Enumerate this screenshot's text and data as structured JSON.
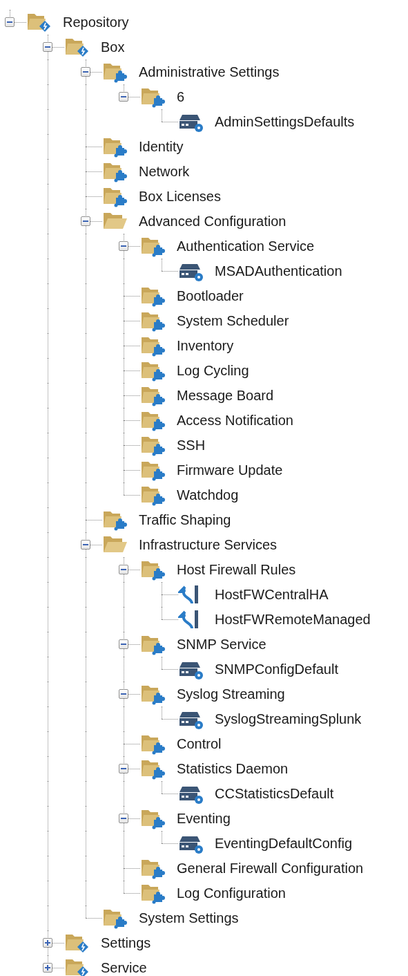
{
  "tree": [
    {
      "label": "Repository",
      "kind": "repo",
      "expanded": true,
      "children": [
        {
          "label": "Box",
          "kind": "repo",
          "expanded": true,
          "children": [
            {
              "label": "Administrative Settings",
              "kind": "config",
              "expanded": true,
              "children": [
                {
                  "label": "6",
                  "kind": "config",
                  "expanded": true,
                  "children": [
                    {
                      "label": "AdminSettingsDefaults",
                      "kind": "object"
                    }
                  ]
                }
              ]
            },
            {
              "label": "Identity",
              "kind": "config"
            },
            {
              "label": "Network",
              "kind": "config"
            },
            {
              "label": "Box Licenses",
              "kind": "config"
            },
            {
              "label": "Advanced Configuration",
              "kind": "open",
              "expanded": true,
              "children": [
                {
                  "label": "Authentication Service",
                  "kind": "config",
                  "expanded": true,
                  "children": [
                    {
                      "label": "MSADAuthentication",
                      "kind": "object"
                    }
                  ]
                },
                {
                  "label": "Bootloader",
                  "kind": "config"
                },
                {
                  "label": "System Scheduler",
                  "kind": "config"
                },
                {
                  "label": "Inventory",
                  "kind": "config"
                },
                {
                  "label": "Log Cycling",
                  "kind": "config"
                },
                {
                  "label": "Message Board",
                  "kind": "config"
                },
                {
                  "label": "Access Notification",
                  "kind": "config"
                },
                {
                  "label": "SSH",
                  "kind": "config"
                },
                {
                  "label": "Firmware Update",
                  "kind": "config"
                },
                {
                  "label": "Watchdog",
                  "kind": "config"
                }
              ]
            },
            {
              "label": "Traffic Shaping",
              "kind": "config"
            },
            {
              "label": "Infrastructure Services",
              "kind": "open",
              "expanded": true,
              "children": [
                {
                  "label": "Host Firewall Rules",
                  "kind": "config",
                  "expanded": true,
                  "children": [
                    {
                      "label": "HostFWCentralHA",
                      "kind": "rule"
                    },
                    {
                      "label": "HostFWRemoteManaged",
                      "kind": "rule"
                    }
                  ]
                },
                {
                  "label": "SNMP Service",
                  "kind": "config",
                  "expanded": true,
                  "children": [
                    {
                      "label": "SNMPConfigDefault",
                      "kind": "object"
                    }
                  ]
                },
                {
                  "label": "Syslog Streaming",
                  "kind": "config",
                  "expanded": true,
                  "children": [
                    {
                      "label": "SyslogStreamingSplunk",
                      "kind": "object"
                    }
                  ]
                },
                {
                  "label": "Control",
                  "kind": "config"
                },
                {
                  "label": "Statistics Daemon",
                  "kind": "config",
                  "expanded": true,
                  "children": [
                    {
                      "label": "CCStatisticsDefault",
                      "kind": "object"
                    }
                  ]
                },
                {
                  "label": "Eventing",
                  "kind": "config",
                  "expanded": true,
                  "children": [
                    {
                      "label": "EventingDefaultConfig",
                      "kind": "object"
                    }
                  ]
                },
                {
                  "label": "General Firewall Configuration",
                  "kind": "config"
                },
                {
                  "label": "Log Configuration",
                  "kind": "config"
                }
              ]
            },
            {
              "label": "System Settings",
              "kind": "config"
            }
          ]
        },
        {
          "label": "Settings",
          "kind": "repo",
          "expanded": false
        },
        {
          "label": "Service",
          "kind": "repo",
          "expanded": false
        }
      ]
    }
  ]
}
